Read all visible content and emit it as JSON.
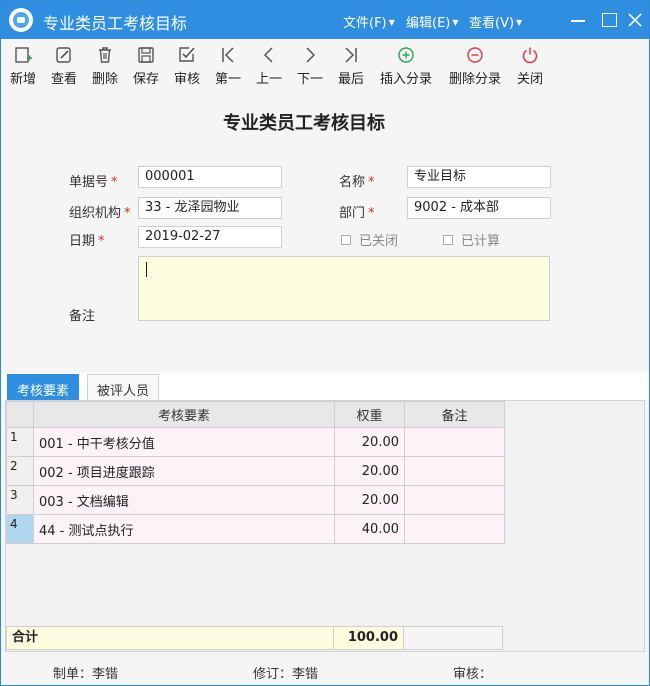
{
  "window": {
    "title": "专业类员工考核目标"
  },
  "menu": {
    "file": "文件(F)",
    "edit": "编辑(E)",
    "view": "查看(V)"
  },
  "toolbar": {
    "new": "新增",
    "view": "查看",
    "delete": "删除",
    "save": "保存",
    "audit": "审核",
    "first": "第一",
    "prev": "上一",
    "next": "下一",
    "last": "最后",
    "insert_entry": "插入分录",
    "delete_entry": "删除分录",
    "close": "关闭"
  },
  "form": {
    "title": "专业类员工考核目标",
    "doc_no_label": "单据号",
    "doc_no": "000001",
    "name_label": "名称",
    "name": "专业目标",
    "org_label": "组织机构",
    "org": "33 - 龙泽园物业",
    "dept_label": "部门",
    "dept": "9002 - 成本部",
    "date_label": "日期",
    "date": "2019-02-27",
    "closed_label": "已关闭",
    "calculated_label": "已计算",
    "remark_label": "备注",
    "remark": "",
    "required_mark": "*"
  },
  "tabs": [
    "考核要素",
    "被评人员"
  ],
  "grid": {
    "headers": [
      "考核要素",
      "权重",
      "备注"
    ],
    "rows": [
      {
        "n": "1",
        "element": "001 - 中干考核分值",
        "weight": "20.00",
        "note": ""
      },
      {
        "n": "2",
        "element": "002 - 项目进度跟踪",
        "weight": "20.00",
        "note": ""
      },
      {
        "n": "3",
        "element": "003 - 文档编辑",
        "weight": "20.00",
        "note": ""
      },
      {
        "n": "4",
        "element": "44 - 测试点执行",
        "weight": "40.00",
        "note": ""
      }
    ],
    "total_label": "合计",
    "total_value": "100.00"
  },
  "footer": {
    "maker": "制单：李锴",
    "reviser": "修订：李锴",
    "auditor": "审核："
  },
  "colors": {
    "accent": "#2f8ee0",
    "required": "#e0282e",
    "highlight": "#fffde0"
  }
}
